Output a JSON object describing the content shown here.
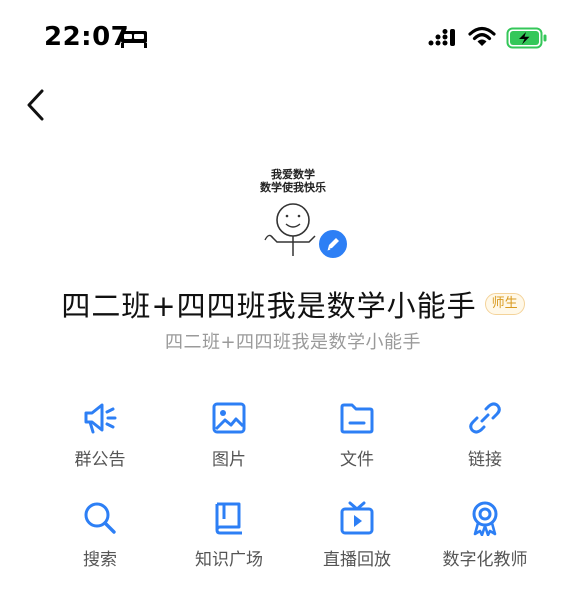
{
  "status_bar": {
    "time": "22:07"
  },
  "avatar": {
    "line1": "我爱数学",
    "line2": "数学使我快乐"
  },
  "group": {
    "name": "四二班+四四班我是数学小能手",
    "role_badge": "师生",
    "subtitle": "四二班+四四班我是数学小能手"
  },
  "actions_row1": [
    {
      "label": "群公告",
      "icon": "megaphone-icon"
    },
    {
      "label": "图片",
      "icon": "image-icon"
    },
    {
      "label": "文件",
      "icon": "folder-icon"
    },
    {
      "label": "链接",
      "icon": "link-icon"
    }
  ],
  "actions_row2": [
    {
      "label": "搜索",
      "icon": "search-icon"
    },
    {
      "label": "知识广场",
      "icon": "book-icon"
    },
    {
      "label": "直播回放",
      "icon": "tv-icon"
    },
    {
      "label": "数字化教师",
      "icon": "badge-icon"
    }
  ],
  "colors": {
    "accent": "#2d7ff5",
    "badge_text": "#d99a1e"
  }
}
